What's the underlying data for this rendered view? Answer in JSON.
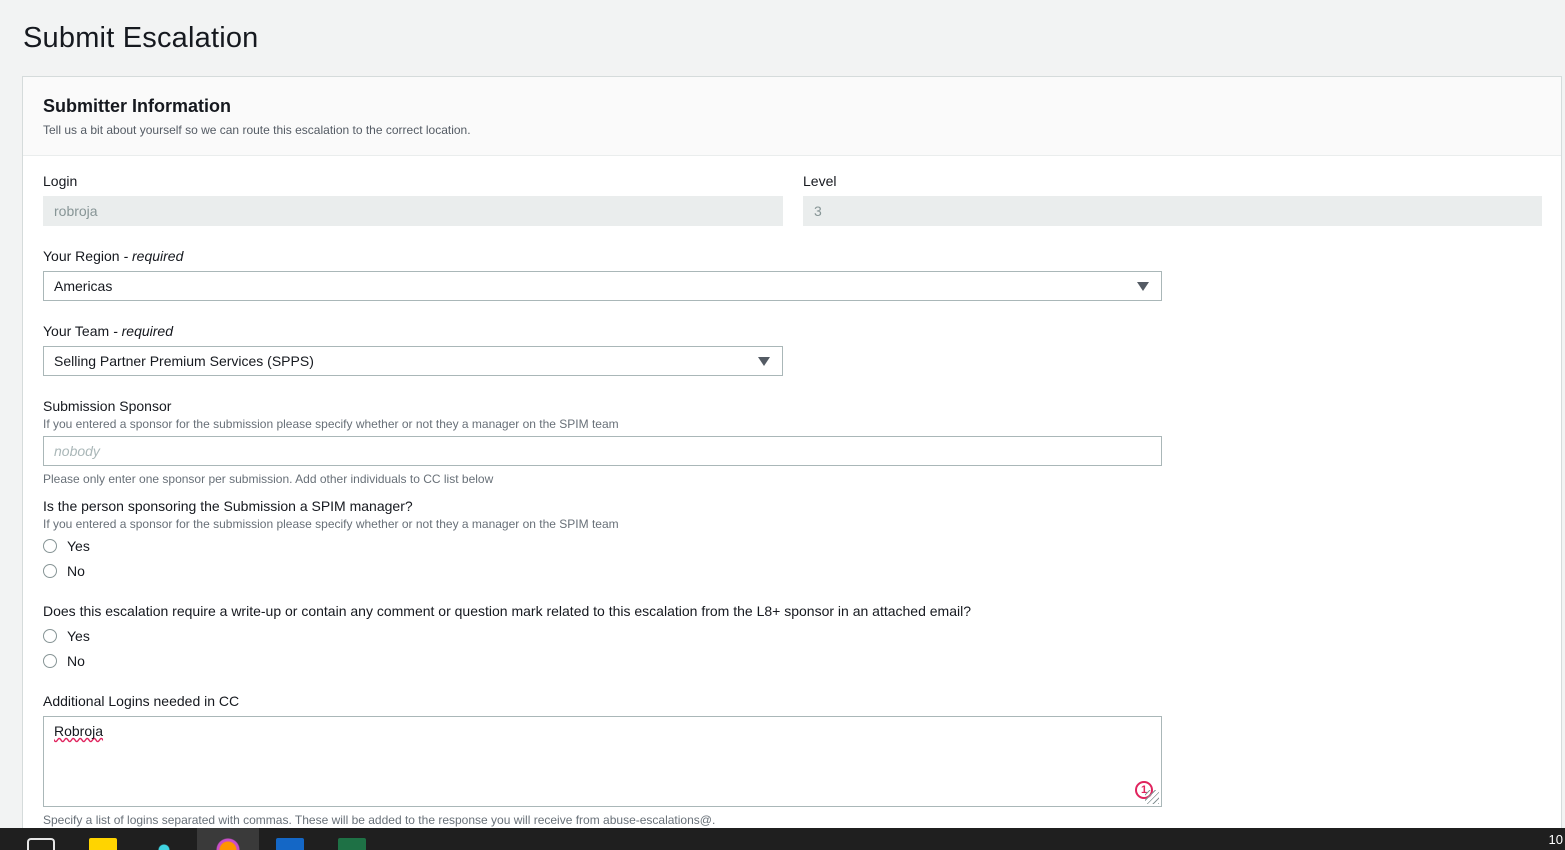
{
  "page": {
    "title": "Submit Escalation"
  },
  "section": {
    "title": "Submitter Information",
    "description": "Tell us a bit about yourself so we can route this escalation to the correct location."
  },
  "login": {
    "label": "Login",
    "value": "robroja"
  },
  "level": {
    "label": "Level",
    "value": "3"
  },
  "region": {
    "label": "Your Region",
    "required": "- required",
    "value": "Americas"
  },
  "team": {
    "label": "Your Team",
    "required": "- required",
    "value": "Selling Partner Premium Services (SPPS)"
  },
  "sponsor": {
    "label": "Submission Sponsor",
    "hint": "If you entered a sponsor for the submission please specify whether or not they a manager on the SPIM team",
    "placeholder": "nobody",
    "helper": "Please only enter one sponsor per submission. Add other individuals to CC list below"
  },
  "spim_manager": {
    "question": "Is the person sponsoring the Submission a SPIM manager?",
    "hint": "If you entered a sponsor for the submission please specify whether or not they a manager on the SPIM team",
    "options": [
      "Yes",
      "No"
    ]
  },
  "writeup": {
    "question": "Does this escalation require a write-up or contain any comment or question mark related to this escalation from the L8+ sponsor in an attached email?",
    "options": [
      "Yes",
      "No"
    ]
  },
  "cc": {
    "label": "Additional Logins needed in CC",
    "value": "Robroja",
    "badge": "1",
    "helper": "Specify a list of logins separated with commas. These will be added to the response you will receive from abuse-escalations@."
  },
  "taskbar": {
    "clock": "10",
    "icons": [
      "store-icon",
      "file-explorer-icon",
      "app-icon",
      "firefox-icon",
      "outlook-icon",
      "excel-icon"
    ]
  },
  "colors": {
    "accent": "#e0245e",
    "panel_border": "#d5dbdb",
    "readonly_bg": "#eaeded"
  }
}
